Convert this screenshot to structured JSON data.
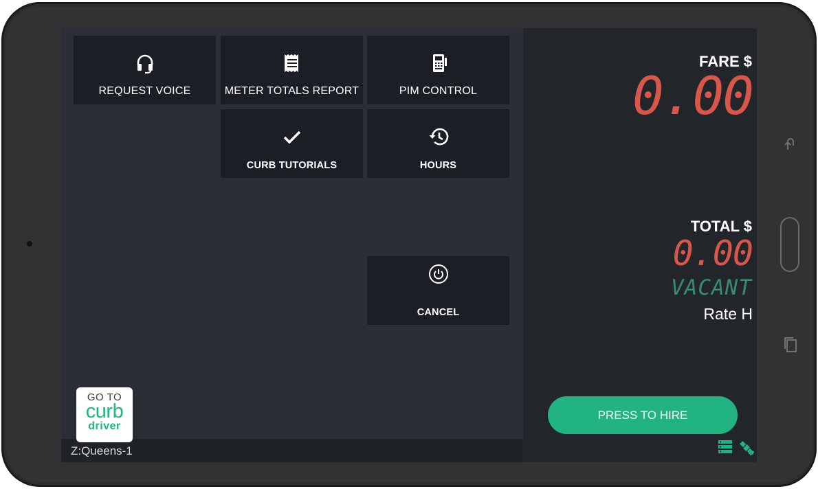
{
  "tiles": {
    "request_voice": "REQUEST VOICE",
    "meter_totals_report": "METER TOTALS REPORT",
    "pim_control": "PIM CONTROL",
    "curb_tutorials": "CURB TUTORIALS",
    "hours": "HOURS",
    "cancel": "CANCEL"
  },
  "meter": {
    "fare_label": "FARE $",
    "fare_value": "0.00",
    "total_label": "TOTAL $",
    "total_value": "0.00",
    "status": "VACANT",
    "rate": "Rate H"
  },
  "hire_button": "PRESS TO HIRE",
  "curb_logo": {
    "line1": "GO TO",
    "brand": "curb",
    "line3": "driver"
  },
  "zone": "Z:Queens-1",
  "icons": {
    "request_voice": "headset-icon",
    "meter_totals_report": "receipt-icon",
    "pim_control": "card-terminal-icon",
    "curb_tutorials": "checkmark-icon",
    "hours": "history-icon",
    "cancel": "power-icon",
    "server_status": "server-icon",
    "gps_status": "satellite-icon"
  },
  "colors": {
    "accent_green": "#22b382",
    "lcd_red": "#d9564b",
    "lcd_green": "#3a8a72"
  }
}
